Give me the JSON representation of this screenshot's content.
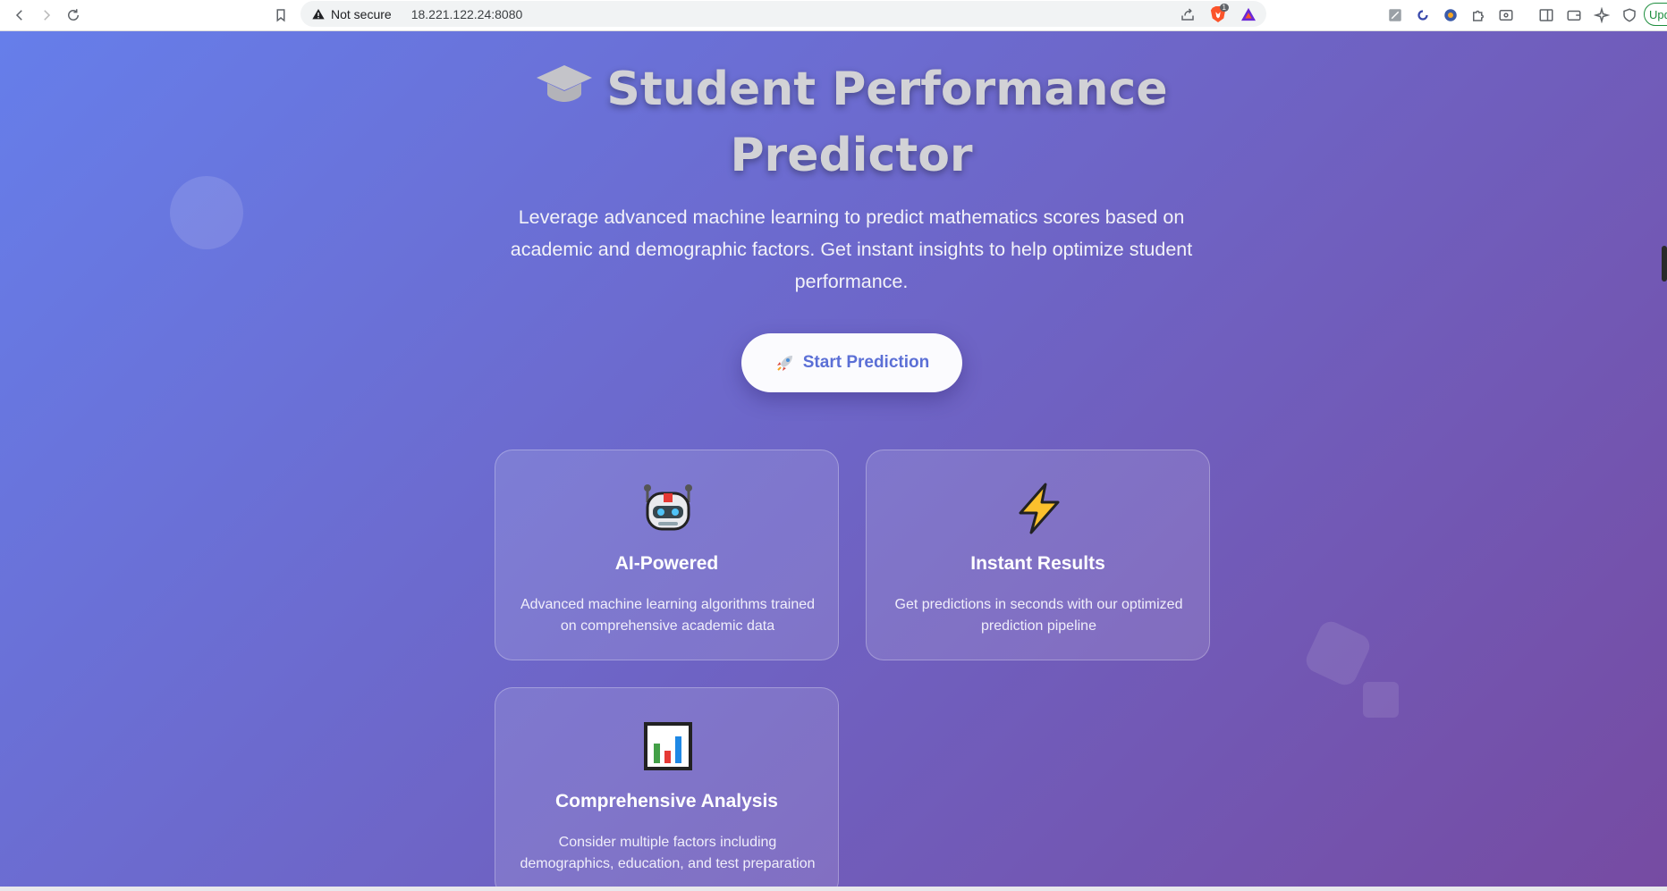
{
  "browser": {
    "security_label": "Not secure",
    "url": "18.221.122.24:8080",
    "update_label": "Upd",
    "brave_badge": "1"
  },
  "hero": {
    "title": "Student Performance Predictor",
    "title_icon": "graduation-cap-icon",
    "subtitle": "Leverage advanced machine learning to predict mathematics scores based on academic and demographic factors. Get instant insights to help optimize student performance.",
    "cta_label": "Start Prediction",
    "cta_icon": "rocket-icon"
  },
  "features": [
    {
      "icon": "robot-icon",
      "title": "AI-Powered",
      "description": "Advanced machine learning algorithms trained on comprehensive academic data"
    },
    {
      "icon": "lightning-icon",
      "title": "Instant Results",
      "description": "Get predictions in seconds with our optimized prediction pipeline"
    },
    {
      "icon": "bar-chart-icon",
      "title": "Comprehensive Analysis",
      "description": "Consider multiple factors including demographics, education, and test preparation"
    }
  ],
  "colors": {
    "gradient_start": "#667eea",
    "gradient_end": "#764ba2",
    "cta_text": "#5b6fd6"
  }
}
